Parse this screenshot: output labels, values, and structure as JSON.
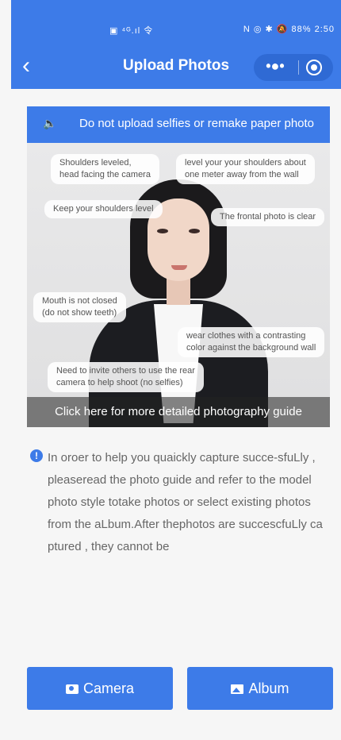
{
  "status_bar": {
    "left_icons": "▣ ⁴ᴳ.ıl 令",
    "right_icons": "N ◎ ✱ 🔕 88%",
    "time": "2:50"
  },
  "nav": {
    "title": "Upload Photos",
    "more": "•●•"
  },
  "notice": {
    "icon": "🔈",
    "text": "Do not upload selfies or remake paper photo"
  },
  "guide": {
    "tips": [
      "Shoulders leveled,\nhead facing the camera",
      "level your your shoulders about\none meter away from the wall",
      "Keep your shoulders level",
      "The frontal photo is clear",
      "Mouth is not closed\n(do not show teeth)",
      "wear clothes with a contrasting\ncolor against the background wall",
      "Need to invite others to use the rear\ncamera to help shoot (no selfies)"
    ],
    "link": "Click here for more detailed photography guide"
  },
  "description": {
    "icon": "!",
    "text": "In oroer to help you quaickly capture succe-sfuLly , pleaseread the photo guide and refer to the model  photo style totake photos or select existing photos from the aLbum.After thephotos are succescfuLly ca ptured , they cannot be"
  },
  "buttons": {
    "camera": "Camera",
    "album": "Album"
  },
  "colors": {
    "accent": "#3d7be8",
    "background": "#f6f6f6",
    "text_secondary": "#666666"
  }
}
